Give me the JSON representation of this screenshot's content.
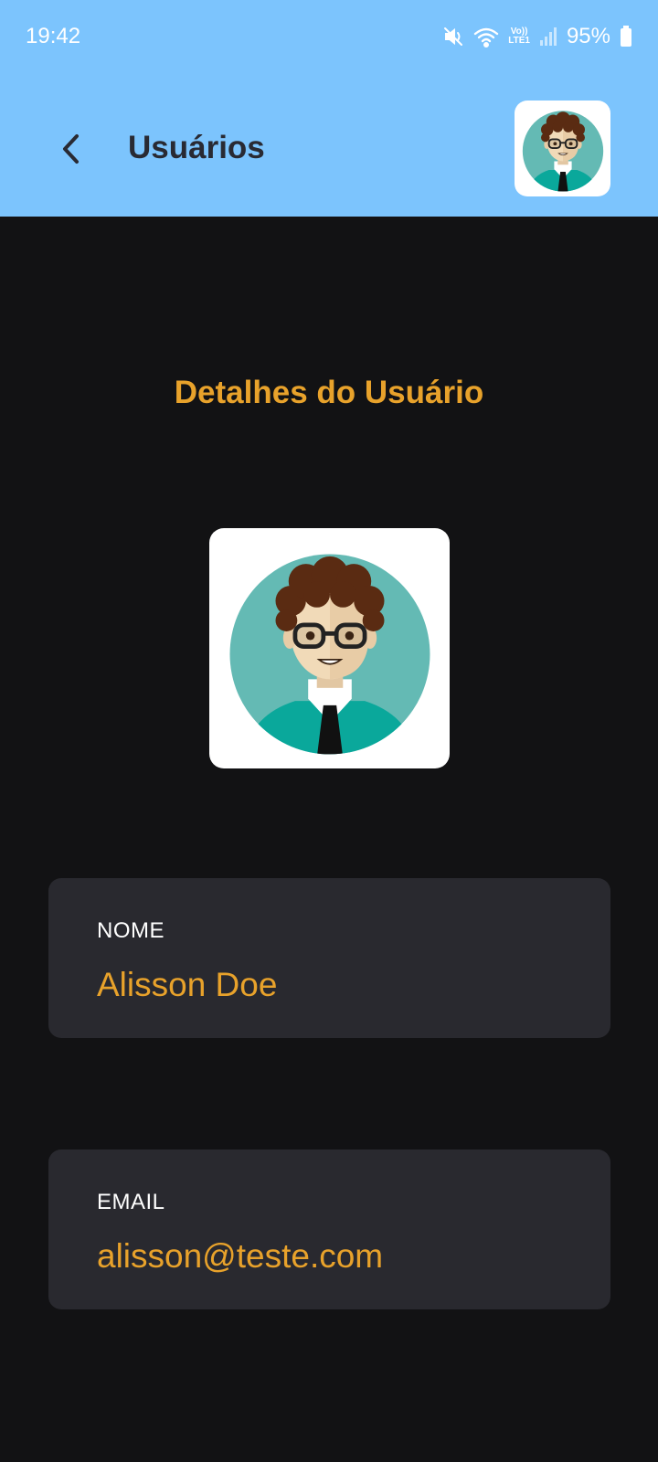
{
  "status_bar": {
    "time": "19:42",
    "battery": "95%",
    "icons": [
      "mute-vibrate-icon",
      "wifi-icon",
      "volte-icon",
      "signal-icon",
      "battery-icon"
    ],
    "volte_label_top": "Vo))",
    "volte_label_bottom": "LTE1"
  },
  "header": {
    "title": "Usuários",
    "back_icon": "chevron-left-icon",
    "background": "#7cc4fd"
  },
  "main": {
    "section_title": "Detalhes do Usuário",
    "fields": [
      {
        "label": "NOME",
        "value": "Alisson Doe"
      },
      {
        "label": "EMAIL",
        "value": "alisson@teste.com"
      }
    ]
  },
  "colors": {
    "accent": "#e8a22b",
    "background": "#121214",
    "card": "#29292f",
    "header": "#7cc4fd"
  }
}
